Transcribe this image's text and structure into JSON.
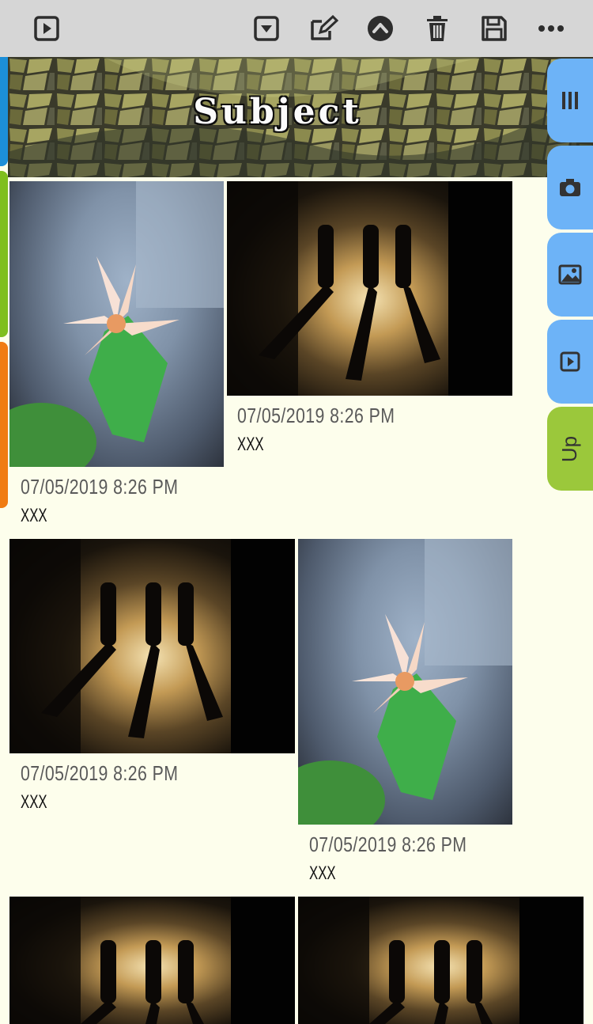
{
  "toolbar": {
    "icons": [
      "play-box-icon",
      "dropdown-box-icon",
      "edit-icon",
      "chevron-up-circle-icon",
      "trash-icon",
      "save-icon",
      "more-icon"
    ]
  },
  "banner": {
    "title": "Subject"
  },
  "side_tabs": {
    "items": [
      "columns-icon",
      "camera-icon",
      "gallery-icon",
      "play-box-icon"
    ],
    "up_label": "Up"
  },
  "cards": [
    {
      "date": "07/05/2019  8:26 PM",
      "caption": "XXX",
      "image": "flower"
    },
    {
      "date": "07/05/2019  8:26 PM",
      "caption": "XXX",
      "image": "walking-people"
    },
    {
      "date": "07/05/2019  8:26 PM",
      "caption": "XXX",
      "image": "walking-people"
    },
    {
      "date": "07/05/2019  8:26 PM",
      "caption": "XXX",
      "image": "flower"
    },
    {
      "date": "",
      "caption": "",
      "image": "walking-people"
    },
    {
      "date": "",
      "caption": "",
      "image": "walking-people"
    }
  ],
  "colors": {
    "toolbar": "#d6d6d6",
    "background": "#fdfeec",
    "tab_blue": "#6db3f7",
    "tab_green": "#9bc83b",
    "strip_blue": "#1c8fd8",
    "strip_green": "#7fbf1e",
    "strip_orange": "#f07c12"
  }
}
